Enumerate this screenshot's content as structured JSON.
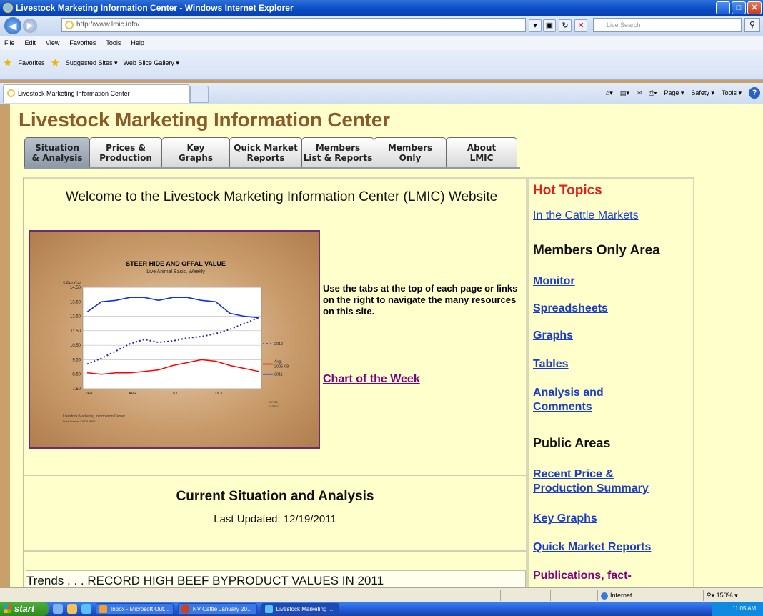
{
  "window": {
    "title": "Livestock Marketing Information Center - Windows Internet Explorer"
  },
  "toolbar": {
    "url": "http://www.lmic.info/",
    "search_placeholder": "Live Search"
  },
  "menu": [
    "File",
    "Edit",
    "View",
    "Favorites",
    "Tools",
    "Help"
  ],
  "favorites_bar": {
    "favorites_label": "Favorites",
    "suggested_sites": "Suggested Sites ▾",
    "web_slice": "Web Slice Gallery ▾"
  },
  "browser_tab": {
    "title": "Livestock Marketing Information Center"
  },
  "command_bar": {
    "page": "Page ▾",
    "safety": "Safety ▾",
    "tools": "Tools ▾"
  },
  "site": {
    "title": "Livestock Marketing Information Center",
    "tabs": [
      {
        "line1": "Situation",
        "line2": "& Analysis"
      },
      {
        "line1": "Prices &",
        "line2": "Production"
      },
      {
        "line1": "Key",
        "line2": "Graphs"
      },
      {
        "line1": "Quick Market",
        "line2": "Reports"
      },
      {
        "line1": "Members",
        "line2": "List & Reports"
      },
      {
        "line1": "Members",
        "line2": "Only"
      },
      {
        "line1": "About",
        "line2": "LMIC"
      }
    ],
    "welcome": "Welcome to the Livestock Marketing Information Center (LMIC) Website",
    "nav_text": "Use the tabs at the top of each page or links on the right to navigate the many resources on this site.",
    "chart_of_week": "Chart of the Week",
    "current_heading": "Current Situation and Analysis",
    "last_updated": "Last Updated: 12/19/2011",
    "trends": "Trends . . . RECORD HIGH BEEF BYPRODUCT VALUES IN 2011"
  },
  "sidebar": {
    "hot_topics": "Hot Topics",
    "cattle_markets": "In the Cattle Markets",
    "members_only": "Members Only Area",
    "monitor": "Monitor",
    "spreadsheets": "Spreadsheets",
    "graphs": "Graphs",
    "tables": "Tables",
    "analysis_line1": "Analysis and",
    "analysis_line2": "Comments",
    "public_areas": "Public Areas",
    "recent_line1": "Recent Price &",
    "recent_line2": "Production Summary",
    "key_graphs": "Key Graphs",
    "quick_reports": "Quick Market Reports",
    "publications": "Publications, fact-"
  },
  "statusbar": {
    "zone": "Internet",
    "zoom": "150%"
  },
  "taskbar": {
    "start": "start",
    "buttons": [
      "Inbox - Microsoft Out...",
      "NV Cattle January 20...",
      "Livestock Marketing I..."
    ],
    "clock": "11:05 AM"
  },
  "chart_data": {
    "type": "line",
    "title": "STEER HIDE AND OFFAL VALUE",
    "subtitle": "Live Animal Basis, Weekly",
    "ylabel": "$ Per Cwt.",
    "ylim": [
      7.5,
      14.5
    ],
    "yticks": [
      "14.50",
      "13.50",
      "12.50",
      "11.50",
      "10.50",
      "9.50",
      "8.50",
      "7.50"
    ],
    "xticks": [
      "JAN",
      "APR",
      "JUL",
      "OCT"
    ],
    "footer": "Livestock Marketing Information Center",
    "source": "Data Source: USDA-AMS",
    "code": "C-P-29\n12/19/11",
    "colors": {
      "avg": "#ff0000",
      "y2010": "#2020c0",
      "y2011": "#1030e0"
    },
    "series": [
      {
        "name": "Avg. 2005-09",
        "values": [
          8.6,
          8.5,
          8.6,
          8.6,
          8.7,
          8.8,
          9.1,
          9.3,
          9.5,
          9.4,
          9.1,
          8.9,
          8.7
        ]
      },
      {
        "name": "2010",
        "values": [
          9.2,
          9.6,
          10.1,
          10.6,
          10.9,
          10.7,
          10.8,
          11.0,
          11.1,
          11.3,
          11.6,
          12.0,
          12.4
        ]
      },
      {
        "name": "2011",
        "values": [
          12.8,
          13.5,
          13.6,
          13.8,
          13.8,
          13.6,
          13.8,
          13.8,
          13.6,
          13.5,
          12.7,
          12.5,
          12.4
        ]
      }
    ]
  }
}
